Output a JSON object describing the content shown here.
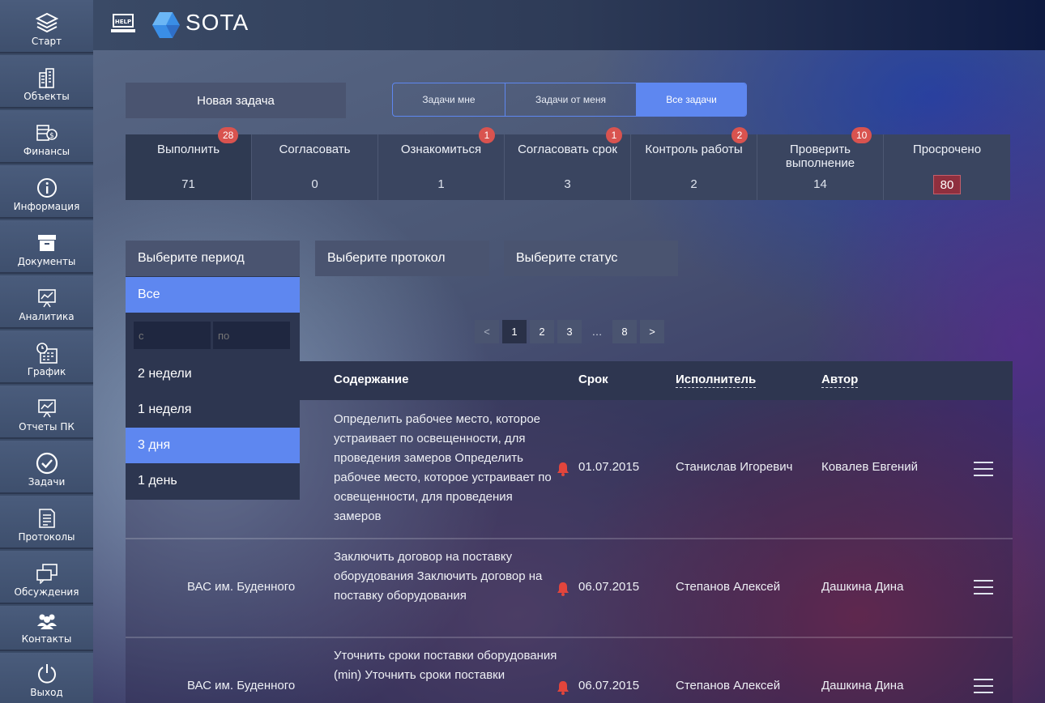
{
  "app": {
    "name": "SOTA",
    "help_label": "HELP"
  },
  "sidebar": {
    "items": [
      {
        "label": "Старт",
        "icon": "layers-icon"
      },
      {
        "label": "Объекты",
        "icon": "buildings-icon"
      },
      {
        "label": "Финансы",
        "icon": "money-icon"
      },
      {
        "label": "Информация",
        "icon": "info-icon"
      },
      {
        "label": "Документы",
        "icon": "archive-box-icon"
      },
      {
        "label": "Аналитика",
        "icon": "presentation-chart-icon"
      },
      {
        "label": "График",
        "icon": "calendar-clock-icon"
      },
      {
        "label": "Отчеты ПК",
        "icon": "report-chart-icon"
      },
      {
        "label": "Задачи",
        "icon": "check-circle-icon"
      },
      {
        "label": "Протоколы",
        "icon": "document-list-icon"
      },
      {
        "label": "Обсуждения",
        "icon": "chat-windows-icon"
      },
      {
        "label": "Контакты",
        "icon": "people-icon"
      },
      {
        "label": "Выход",
        "icon": "power-icon"
      }
    ]
  },
  "toolbar": {
    "new_task": "Новая задача",
    "segments": [
      "Задачи мне",
      "Задачи от меня",
      "Все задачи"
    ],
    "active_segment": "Все задачи"
  },
  "stats": [
    {
      "title": "Выполнить",
      "count": "71",
      "badge": "28"
    },
    {
      "title": "Согласовать",
      "count": "0",
      "badge": ""
    },
    {
      "title": "Ознакомиться",
      "count": "1",
      "badge": "1"
    },
    {
      "title": "Согласовать срок",
      "count": "3",
      "badge": "1"
    },
    {
      "title": "Контроль работы",
      "count": "2",
      "badge": "2"
    },
    {
      "title": "Проверить выполнение",
      "count": "14",
      "badge": "10"
    },
    {
      "title": "Просрочено",
      "count": "80",
      "badge": ""
    }
  ],
  "filters": {
    "period": "Выберите период",
    "protocol": "Выберите протокол",
    "status": "Выберите статус"
  },
  "period_dropdown": {
    "all": "Все",
    "from_placeholder": "с",
    "to_placeholder": "по",
    "options": [
      "2 недели",
      "1 неделя",
      "3 дня",
      "1 день"
    ],
    "selected": "3 дня"
  },
  "pagination": {
    "prev": "<",
    "pages": [
      "1",
      "2",
      "3"
    ],
    "dots": "…",
    "last": "8",
    "next": ">",
    "current": "1"
  },
  "table": {
    "headers": {
      "content": "Содержание",
      "due": "Срок",
      "assignee": "Исполнитель",
      "author": "Автор"
    },
    "rows": [
      {
        "object": "",
        "content": "Определить рабочее место, которое устраивает по освещенности, для проведения замеров Определить рабочее место, которое устраивает по освещенности, для проведения замеров",
        "due": "01.07.2015",
        "assignee": "Станислав Игоревич",
        "author": "Ковалев Евгений"
      },
      {
        "object": "ВАС им. Буденного",
        "content": "Заключить договор на поставку оборудования Заключить договор на поставку оборудования",
        "due": "06.07.2015",
        "assignee": "Степанов Алексей",
        "author": "Дашкина Дина"
      },
      {
        "object": "ВАС им. Буденного",
        "content": "Уточнить сроки поставки оборудования (min) Уточнить сроки поставки",
        "due": "06.07.2015",
        "assignee": "Степанов Алексей",
        "author": "Дашкина Дина"
      }
    ]
  },
  "colors": {
    "accent": "#5e87f0",
    "badge": "#d9534f",
    "bell": "#e2453c"
  }
}
